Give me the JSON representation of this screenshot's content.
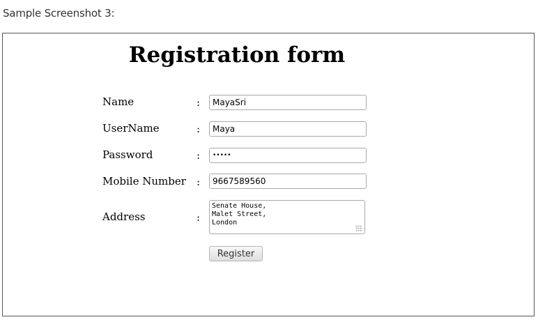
{
  "caption": "Sample Screenshot 3:",
  "form": {
    "title": "Registration form",
    "separator": ":",
    "fields": {
      "name": {
        "label": "Name",
        "value": "MayaSri"
      },
      "username": {
        "label": "UserName",
        "value": "Maya"
      },
      "password": {
        "label": "Password",
        "value": "•••••"
      },
      "mobile": {
        "label": "Mobile Number",
        "value": "9667589560"
      },
      "address": {
        "label": "Address",
        "value": "Senate House,\nMalet Street,\nLondon"
      }
    },
    "submit_label": "Register"
  }
}
